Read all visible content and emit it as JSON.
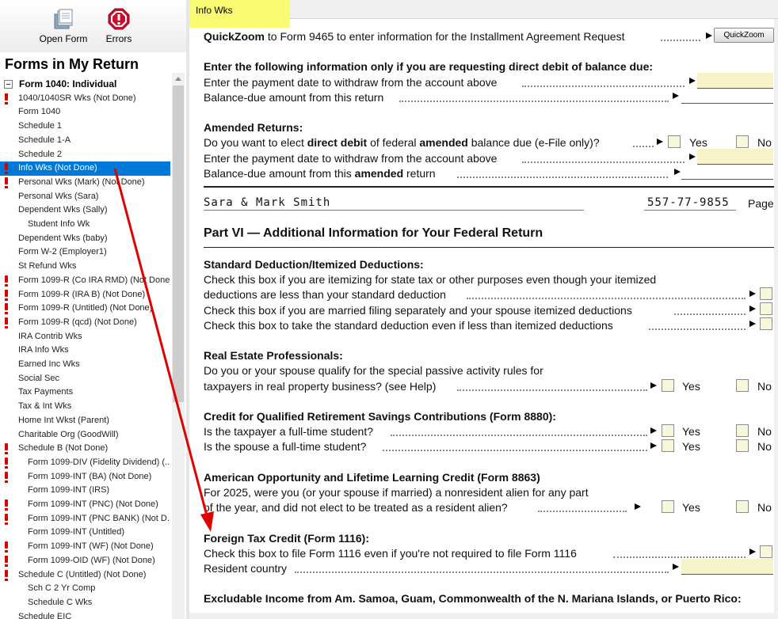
{
  "toolbar": {
    "open_form": "Open Form",
    "errors": "Errors"
  },
  "sidebar": {
    "title": "Forms in My Return",
    "root": "Form 1040:  Individual",
    "items": [
      {
        "label": "1040/1040SR Wks (Not Done)",
        "err": true,
        "indent": 1
      },
      {
        "label": "Form 1040",
        "err": false,
        "indent": 1
      },
      {
        "label": "Schedule 1",
        "err": false,
        "indent": 1
      },
      {
        "label": "Schedule 1-A",
        "err": false,
        "indent": 1
      },
      {
        "label": "Schedule 2",
        "err": false,
        "indent": 1
      },
      {
        "label": "Info Wks (Not Done)",
        "err": true,
        "indent": 1,
        "selected": true
      },
      {
        "label": "Personal Wks (Mark) (Not Done)",
        "err": true,
        "indent": 1
      },
      {
        "label": "Personal Wks (Sara)",
        "err": false,
        "indent": 1
      },
      {
        "label": "Dependent Wks (Sally)",
        "err": false,
        "indent": 1
      },
      {
        "label": "Student Info Wk",
        "err": false,
        "indent": 2
      },
      {
        "label": "Dependent Wks (baby)",
        "err": false,
        "indent": 1
      },
      {
        "label": "Form W-2 (Employer1)",
        "err": false,
        "indent": 1
      },
      {
        "label": "St Refund Wks",
        "err": false,
        "indent": 1
      },
      {
        "label": "Form 1099-R (Co IRA RMD) (Not Done)",
        "err": true,
        "indent": 1
      },
      {
        "label": "Form 1099-R (IRA B) (Not Done)",
        "err": true,
        "indent": 1
      },
      {
        "label": "Form 1099-R (Untitled) (Not Done)",
        "err": true,
        "indent": 1
      },
      {
        "label": "Form 1099-R (qcd) (Not Done)",
        "err": true,
        "indent": 1
      },
      {
        "label": "IRA Contrib Wks",
        "err": false,
        "indent": 1
      },
      {
        "label": "IRA Info Wks",
        "err": false,
        "indent": 1
      },
      {
        "label": "Earned Inc Wks",
        "err": false,
        "indent": 1
      },
      {
        "label": "Social Sec",
        "err": false,
        "indent": 1
      },
      {
        "label": "Tax Payments",
        "err": false,
        "indent": 1
      },
      {
        "label": "Tax & Int Wks",
        "err": false,
        "indent": 1
      },
      {
        "label": "Home Int Wkst (Parent)",
        "err": false,
        "indent": 1
      },
      {
        "label": "Charitable Org (GoodWill)",
        "err": false,
        "indent": 1
      },
      {
        "label": "Schedule B (Not Done)",
        "err": true,
        "indent": 1
      },
      {
        "label": "Form 1099-DIV (Fidelity Dividend) (...",
        "err": true,
        "indent": 2
      },
      {
        "label": "Form 1099-INT (BA) (Not Done)",
        "err": true,
        "indent": 2
      },
      {
        "label": "Form 1099-INT (IRS)",
        "err": false,
        "indent": 2
      },
      {
        "label": "Form 1099-INT (PNC) (Not Done)",
        "err": true,
        "indent": 2
      },
      {
        "label": "Form 1099-INT (PNC BANK) (Not D...",
        "err": true,
        "indent": 2
      },
      {
        "label": "Form 1099-INT (Untitled)",
        "err": false,
        "indent": 2
      },
      {
        "label": "Form 1099-INT (WF) (Not Done)",
        "err": true,
        "indent": 2
      },
      {
        "label": "Form 1099-OID (WF) (Not Done)",
        "err": true,
        "indent": 2
      },
      {
        "label": "Schedule C (Untitled) (Not Done)",
        "err": true,
        "indent": 1
      },
      {
        "label": "Sch C 2 Yr Comp",
        "err": false,
        "indent": 2
      },
      {
        "label": "Schedule C Wks",
        "err": false,
        "indent": 2
      },
      {
        "label": "Schedule EIC",
        "err": false,
        "indent": 1
      }
    ]
  },
  "tab": {
    "label": "Info Wks"
  },
  "form": {
    "quickzoom": {
      "bold": "QuickZoom",
      "rest": " to Form 9465 to enter information for the Installment Agreement Request",
      "button": "QuickZoom"
    },
    "direct_debit": {
      "heading": "Enter the following information only if you are requesting direct debit of balance due:",
      "payment_date": "Enter the payment date to withdraw from the account above",
      "balance_due": "Balance-due amount from this return"
    },
    "amended": {
      "heading": "Amended Returns:",
      "q_pre": "Do you want to elect ",
      "q_b1": "direct debit",
      "q_mid": " of federal ",
      "q_b2": "amended",
      "q_post": " balance due (e-File only)?",
      "payment_date": "Enter the payment date to withdraw from the account above",
      "balance_pre": "Balance-due amount from this ",
      "balance_b": "amended",
      "balance_post": " return"
    },
    "names": "Sara & Mark Smith",
    "ssn": "557-77-9855",
    "page": "Page",
    "part_vi": "Part VI — Additional Information for Your Federal Return",
    "std_ded": {
      "heading": "Standard Deduction/Itemized Deductions:",
      "l1": "Check this box if you are itemizing for state tax or other purposes even though your itemized",
      "l2": "deductions are less than your standard deduction",
      "l3": "Check this box if you are married filing separately and your spouse itemized deductions",
      "l4": "Check this box to take the standard deduction even if less than itemized deductions"
    },
    "real_estate": {
      "heading": "Real Estate Professionals:",
      "l1": "Do you or your spouse qualify for the special passive activity rules for",
      "l2": "taxpayers in real property business? (see Help)"
    },
    "savers": {
      "heading": "Credit for Qualified Retirement Savings Contributions (Form 8880):",
      "l1": "Is the taxpayer a full-time student?",
      "l2": "Is the spouse a full-time student?"
    },
    "aotc": {
      "heading": "American Opportunity and Lifetime Learning Credit  (Form 8863)",
      "l1": "For 2025, were you (or your spouse if married) a nonresident alien for any part",
      "l2": "of the year, and did not elect to be treated as a resident alien?"
    },
    "ftc": {
      "heading": "Foreign Tax Credit (Form 1116):",
      "l1": "Check this box to file Form 1116 even if you're not required to file Form 1116",
      "l2": "Resident country"
    },
    "excludable": {
      "heading": "Excludable Income  from Am. Samoa, Guam, Commonwealth of the N.  Mariana Islands, or Puerto Rico:"
    },
    "yes": "Yes",
    "no": "No"
  },
  "colors": {
    "selection": "#0078d7",
    "tab_highlight": "#fbfb72",
    "arrow": "#e00000",
    "error": "#d40000",
    "field_yellow": "#f7f3c8"
  }
}
